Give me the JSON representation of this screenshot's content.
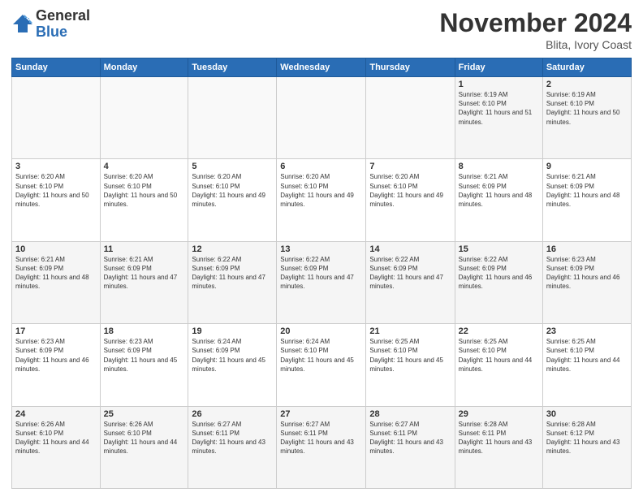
{
  "logo": {
    "general": "General",
    "blue": "Blue"
  },
  "title": "November 2024",
  "location": "Blita, Ivory Coast",
  "weekdays": [
    "Sunday",
    "Monday",
    "Tuesday",
    "Wednesday",
    "Thursday",
    "Friday",
    "Saturday"
  ],
  "weeks": [
    [
      {
        "day": "",
        "info": ""
      },
      {
        "day": "",
        "info": ""
      },
      {
        "day": "",
        "info": ""
      },
      {
        "day": "",
        "info": ""
      },
      {
        "day": "",
        "info": ""
      },
      {
        "day": "1",
        "info": "Sunrise: 6:19 AM\nSunset: 6:10 PM\nDaylight: 11 hours and 51 minutes."
      },
      {
        "day": "2",
        "info": "Sunrise: 6:19 AM\nSunset: 6:10 PM\nDaylight: 11 hours and 50 minutes."
      }
    ],
    [
      {
        "day": "3",
        "info": "Sunrise: 6:20 AM\nSunset: 6:10 PM\nDaylight: 11 hours and 50 minutes."
      },
      {
        "day": "4",
        "info": "Sunrise: 6:20 AM\nSunset: 6:10 PM\nDaylight: 11 hours and 50 minutes."
      },
      {
        "day": "5",
        "info": "Sunrise: 6:20 AM\nSunset: 6:10 PM\nDaylight: 11 hours and 49 minutes."
      },
      {
        "day": "6",
        "info": "Sunrise: 6:20 AM\nSunset: 6:10 PM\nDaylight: 11 hours and 49 minutes."
      },
      {
        "day": "7",
        "info": "Sunrise: 6:20 AM\nSunset: 6:10 PM\nDaylight: 11 hours and 49 minutes."
      },
      {
        "day": "8",
        "info": "Sunrise: 6:21 AM\nSunset: 6:09 PM\nDaylight: 11 hours and 48 minutes."
      },
      {
        "day": "9",
        "info": "Sunrise: 6:21 AM\nSunset: 6:09 PM\nDaylight: 11 hours and 48 minutes."
      }
    ],
    [
      {
        "day": "10",
        "info": "Sunrise: 6:21 AM\nSunset: 6:09 PM\nDaylight: 11 hours and 48 minutes."
      },
      {
        "day": "11",
        "info": "Sunrise: 6:21 AM\nSunset: 6:09 PM\nDaylight: 11 hours and 47 minutes."
      },
      {
        "day": "12",
        "info": "Sunrise: 6:22 AM\nSunset: 6:09 PM\nDaylight: 11 hours and 47 minutes."
      },
      {
        "day": "13",
        "info": "Sunrise: 6:22 AM\nSunset: 6:09 PM\nDaylight: 11 hours and 47 minutes."
      },
      {
        "day": "14",
        "info": "Sunrise: 6:22 AM\nSunset: 6:09 PM\nDaylight: 11 hours and 47 minutes."
      },
      {
        "day": "15",
        "info": "Sunrise: 6:22 AM\nSunset: 6:09 PM\nDaylight: 11 hours and 46 minutes."
      },
      {
        "day": "16",
        "info": "Sunrise: 6:23 AM\nSunset: 6:09 PM\nDaylight: 11 hours and 46 minutes."
      }
    ],
    [
      {
        "day": "17",
        "info": "Sunrise: 6:23 AM\nSunset: 6:09 PM\nDaylight: 11 hours and 46 minutes."
      },
      {
        "day": "18",
        "info": "Sunrise: 6:23 AM\nSunset: 6:09 PM\nDaylight: 11 hours and 45 minutes."
      },
      {
        "day": "19",
        "info": "Sunrise: 6:24 AM\nSunset: 6:09 PM\nDaylight: 11 hours and 45 minutes."
      },
      {
        "day": "20",
        "info": "Sunrise: 6:24 AM\nSunset: 6:10 PM\nDaylight: 11 hours and 45 minutes."
      },
      {
        "day": "21",
        "info": "Sunrise: 6:25 AM\nSunset: 6:10 PM\nDaylight: 11 hours and 45 minutes."
      },
      {
        "day": "22",
        "info": "Sunrise: 6:25 AM\nSunset: 6:10 PM\nDaylight: 11 hours and 44 minutes."
      },
      {
        "day": "23",
        "info": "Sunrise: 6:25 AM\nSunset: 6:10 PM\nDaylight: 11 hours and 44 minutes."
      }
    ],
    [
      {
        "day": "24",
        "info": "Sunrise: 6:26 AM\nSunset: 6:10 PM\nDaylight: 11 hours and 44 minutes."
      },
      {
        "day": "25",
        "info": "Sunrise: 6:26 AM\nSunset: 6:10 PM\nDaylight: 11 hours and 44 minutes."
      },
      {
        "day": "26",
        "info": "Sunrise: 6:27 AM\nSunset: 6:11 PM\nDaylight: 11 hours and 43 minutes."
      },
      {
        "day": "27",
        "info": "Sunrise: 6:27 AM\nSunset: 6:11 PM\nDaylight: 11 hours and 43 minutes."
      },
      {
        "day": "28",
        "info": "Sunrise: 6:27 AM\nSunset: 6:11 PM\nDaylight: 11 hours and 43 minutes."
      },
      {
        "day": "29",
        "info": "Sunrise: 6:28 AM\nSunset: 6:11 PM\nDaylight: 11 hours and 43 minutes."
      },
      {
        "day": "30",
        "info": "Sunrise: 6:28 AM\nSunset: 6:12 PM\nDaylight: 11 hours and 43 minutes."
      }
    ]
  ]
}
